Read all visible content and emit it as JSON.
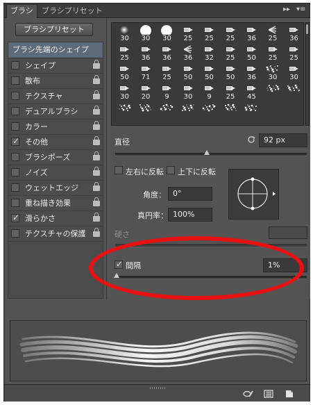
{
  "tabs": [
    {
      "label": "ブラシ",
      "active": true
    },
    {
      "label": "ブラシプリセット",
      "active": false
    }
  ],
  "tab_controls": {
    "collapse": "▸▸",
    "menu": "▾≡"
  },
  "preset_button": "ブラシプリセット",
  "tip_shape_header": "ブラシ先端のシェイプ",
  "options": [
    {
      "label": "シェイプ",
      "checked": false
    },
    {
      "label": "散布",
      "checked": false
    },
    {
      "label": "テクスチャ",
      "checked": false
    },
    {
      "label": "デュアルブラシ",
      "checked": false
    },
    {
      "label": "カラー",
      "checked": false
    },
    {
      "label": "その他",
      "checked": true
    },
    {
      "label": "ブラシポーズ",
      "checked": false
    },
    {
      "label": "ノイズ",
      "checked": false
    },
    {
      "label": "ウェットエッジ",
      "checked": false
    },
    {
      "label": "重ね描き効果",
      "checked": false
    },
    {
      "label": "滑らかさ",
      "checked": true
    },
    {
      "label": "テクスチャの保護",
      "checked": false
    }
  ],
  "brush_grid": [
    {
      "icon": "soft-round-brush-icon",
      "size": "30"
    },
    {
      "icon": "hard-round-brush-icon",
      "size": "30"
    },
    {
      "icon": "hard-round-brush-icon",
      "size": "30"
    },
    {
      "icon": "bristle-brush-icon",
      "size": "25"
    },
    {
      "icon": "bristle-brush-icon",
      "size": "25"
    },
    {
      "icon": "bristle-brush-icon",
      "size": "25"
    },
    {
      "icon": "bristle-brush-icon",
      "size": "36"
    },
    {
      "icon": "bristle-fan-brush-icon",
      "size": "25"
    },
    {
      "icon": "bristle-brush-icon",
      "size": "36"
    },
    {
      "icon": "bristle-brush-icon",
      "size": "25"
    },
    {
      "icon": "bristle-brush-icon",
      "size": "36"
    },
    {
      "icon": "bristle-brush-icon",
      "size": "36"
    },
    {
      "icon": "bristle-fan-brush-icon",
      "size": "36"
    },
    {
      "icon": "bristle-brush-icon",
      "size": "32"
    },
    {
      "icon": "bristle-brush-icon",
      "size": "25"
    },
    {
      "icon": "bristle-brush-icon",
      "size": "50"
    },
    {
      "icon": "bristle-brush-icon",
      "size": "25"
    },
    {
      "icon": "bristle-brush-icon",
      "size": "25"
    },
    {
      "icon": "bristle-brush-icon",
      "size": "50"
    },
    {
      "icon": "bristle-brush-icon",
      "size": "71"
    },
    {
      "icon": "bristle-brush-icon",
      "size": "25"
    },
    {
      "icon": "bristle-brush-icon",
      "size": "50"
    },
    {
      "icon": "bristle-brush-icon",
      "size": "50"
    },
    {
      "icon": "bristle-brush-icon",
      "size": "50"
    },
    {
      "icon": "bristle-brush-icon",
      "size": "36"
    },
    {
      "icon": "splatter-brush-icon",
      "size": "30"
    },
    {
      "icon": "bristle-brush-icon",
      "size": "30"
    },
    {
      "icon": "bristle-brush-icon",
      "size": "30"
    },
    {
      "icon": "bristle-brush-icon",
      "size": "20"
    },
    {
      "icon": "bristle-brush-icon",
      "size": "9"
    },
    {
      "icon": "bristle-brush-icon",
      "size": "30"
    },
    {
      "icon": "bristle-brush-icon",
      "size": "9"
    },
    {
      "icon": "bristle-brush-icon",
      "size": "25"
    },
    {
      "icon": "bristle-brush-icon",
      "size": "45"
    },
    {
      "icon": "splatter-brush-icon",
      "size": ""
    },
    {
      "icon": "splatter-brush-icon",
      "size": ""
    },
    {
      "icon": "splatter-brush-icon",
      "size": ""
    },
    {
      "icon": "splatter-brush-icon",
      "size": ""
    },
    {
      "icon": "splatter-brush-icon",
      "size": ""
    },
    {
      "icon": "splatter-brush-icon",
      "size": ""
    },
    {
      "icon": "splatter-brush-icon",
      "size": ""
    },
    {
      "icon": "splatter-brush-icon",
      "size": ""
    },
    {
      "icon": "splatter-brush-icon",
      "size": ""
    }
  ],
  "diameter": {
    "label": "直径",
    "value": "92 px",
    "slider_fraction": 0.48
  },
  "flip_x": {
    "label": "左右に反転",
    "checked": false
  },
  "flip_y": {
    "label": "上下に反転",
    "checked": false
  },
  "angle": {
    "label": "角度：",
    "value": "0°"
  },
  "roundness": {
    "label": "真円率：",
    "value": "100%"
  },
  "hardness": {
    "label": "硬さ",
    "value": ""
  },
  "spacing": {
    "label": "間隔",
    "checked": true,
    "value": "1%",
    "slider_fraction": 0.0
  },
  "highlight_color": "#e81010"
}
